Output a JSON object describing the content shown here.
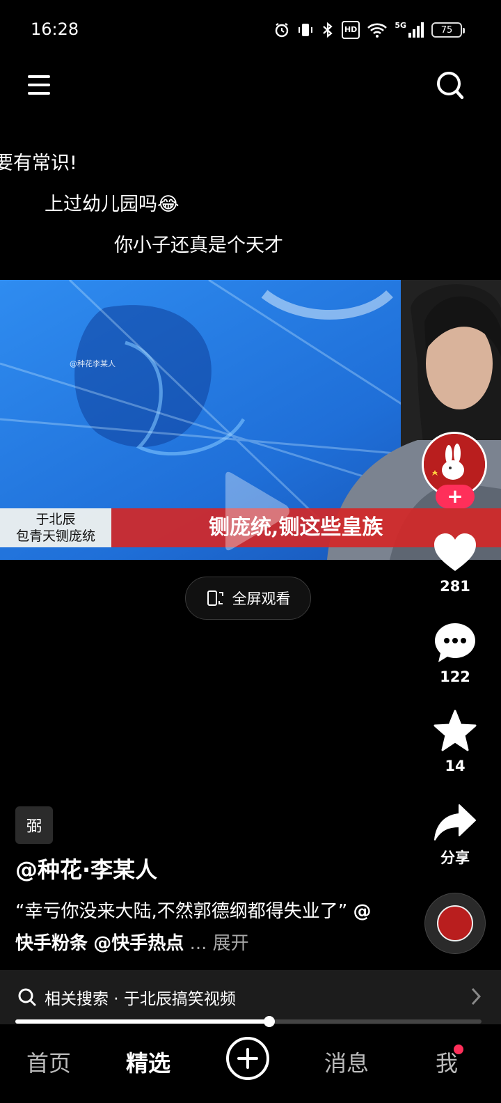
{
  "status_bar": {
    "time": "16:28",
    "hd_label": "HD",
    "network_label": "5G",
    "battery": "75"
  },
  "danmaku": [
    {
      "text": "要有常识!"
    },
    {
      "text": "上过幼儿园吗😂"
    },
    {
      "text": "你小子还真是个天才"
    }
  ],
  "video": {
    "watermark": "@种花李某人",
    "caption_left_line1": "于北辰",
    "caption_left_line2": "包青天铡庞统",
    "caption_main": "铡庞统,铡这些皇族"
  },
  "fullscreen": {
    "label": "全屏观看"
  },
  "rail": {
    "likes": "281",
    "comments": "122",
    "favorites": "14",
    "share_label": "分享",
    "follow_plus": "+"
  },
  "post": {
    "tag": "弼",
    "author": "@种花·李某人",
    "desc_text": "“幸亏你没来大陆,不然郭德纲都得失业了”",
    "mention1": "@快手粉条",
    "mention2": "@快手热点",
    "ellipsis": "...",
    "expand_label": "展开"
  },
  "related_search": {
    "label": "相关搜索 · 于北辰搞笑视频"
  },
  "playback": {
    "progress": 0.545
  },
  "bottom_nav": {
    "home": "首页",
    "featured": "精选",
    "messages": "消息",
    "me": "我"
  },
  "colors": {
    "accent": "#ff2f5a",
    "background": "#000000",
    "caption_red": "#d22828"
  }
}
